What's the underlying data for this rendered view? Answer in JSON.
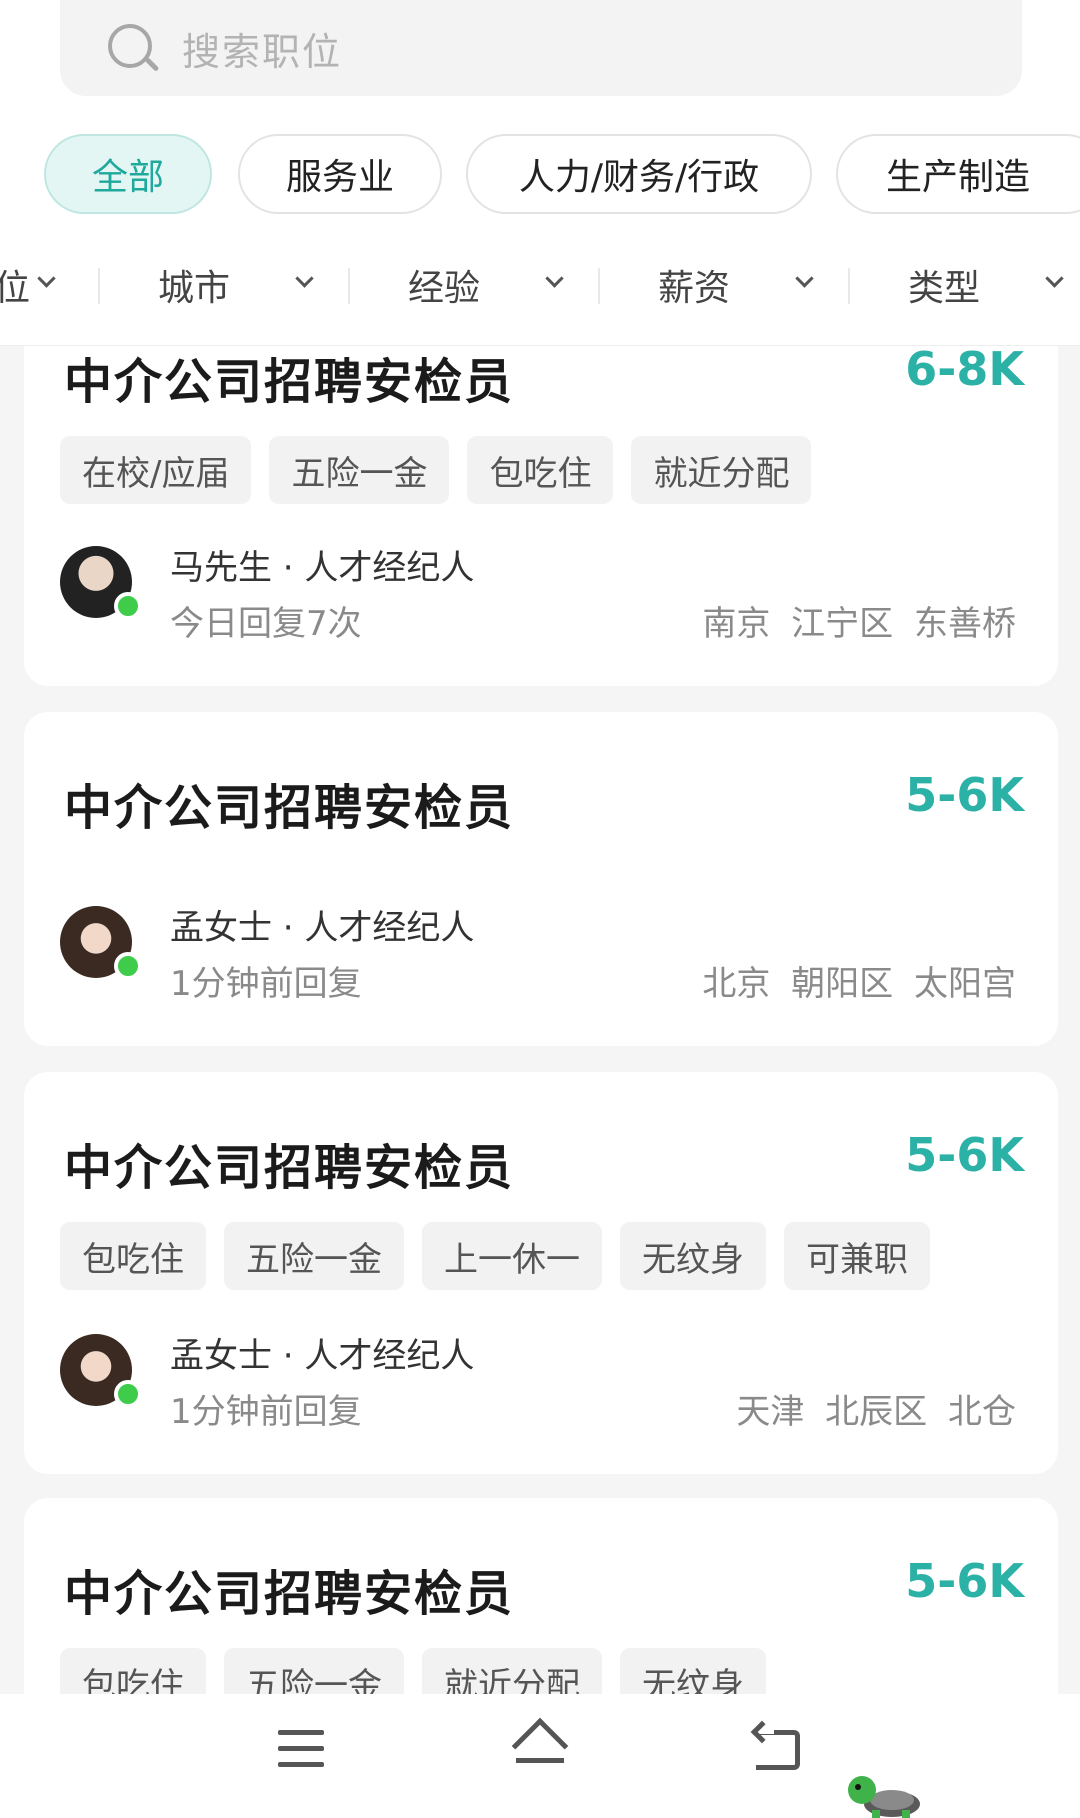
{
  "search": {
    "placeholder": "搜索职位"
  },
  "categories": [
    {
      "label": "全部",
      "active": true
    },
    {
      "label": "服务业",
      "active": false
    },
    {
      "label": "人力/财务/行政",
      "active": false
    },
    {
      "label": "生产制造",
      "active": false
    }
  ],
  "filters": [
    "位",
    "城市",
    "经验",
    "薪资",
    "类型"
  ],
  "jobs": [
    {
      "title": "中介公司招聘安检员",
      "salary": "6-8K",
      "tags": [
        "在校/应届",
        "五险一金",
        "包吃住",
        "就近分配"
      ],
      "agent": "马先生 · 人才经纪人",
      "reply": "今日回复7次",
      "location": "南京  江宁区  东善桥"
    },
    {
      "title": "中介公司招聘安检员",
      "salary": "5-6K",
      "tags": [],
      "agent": "孟女士 · 人才经纪人",
      "reply": "1分钟前回复",
      "location": "北京  朝阳区  太阳宫"
    },
    {
      "title": "中介公司招聘安检员",
      "salary": "5-6K",
      "tags": [
        "包吃住",
        "五险一金",
        "上一休一",
        "无纹身",
        "可兼职"
      ],
      "agent": "孟女士 · 人才经纪人",
      "reply": "1分钟前回复",
      "location": "天津  北辰区  北仓"
    },
    {
      "title": "中介公司招聘安检员",
      "salary": "5-6K",
      "tags": [
        "包吃住",
        "五险一金",
        "就近分配",
        "无纹身"
      ]
    }
  ],
  "colors": {
    "accent": "#2bb1a6",
    "online": "#3fcc4b"
  },
  "nav": {
    "icons": [
      "menu-icon",
      "home-icon",
      "back-icon"
    ]
  }
}
